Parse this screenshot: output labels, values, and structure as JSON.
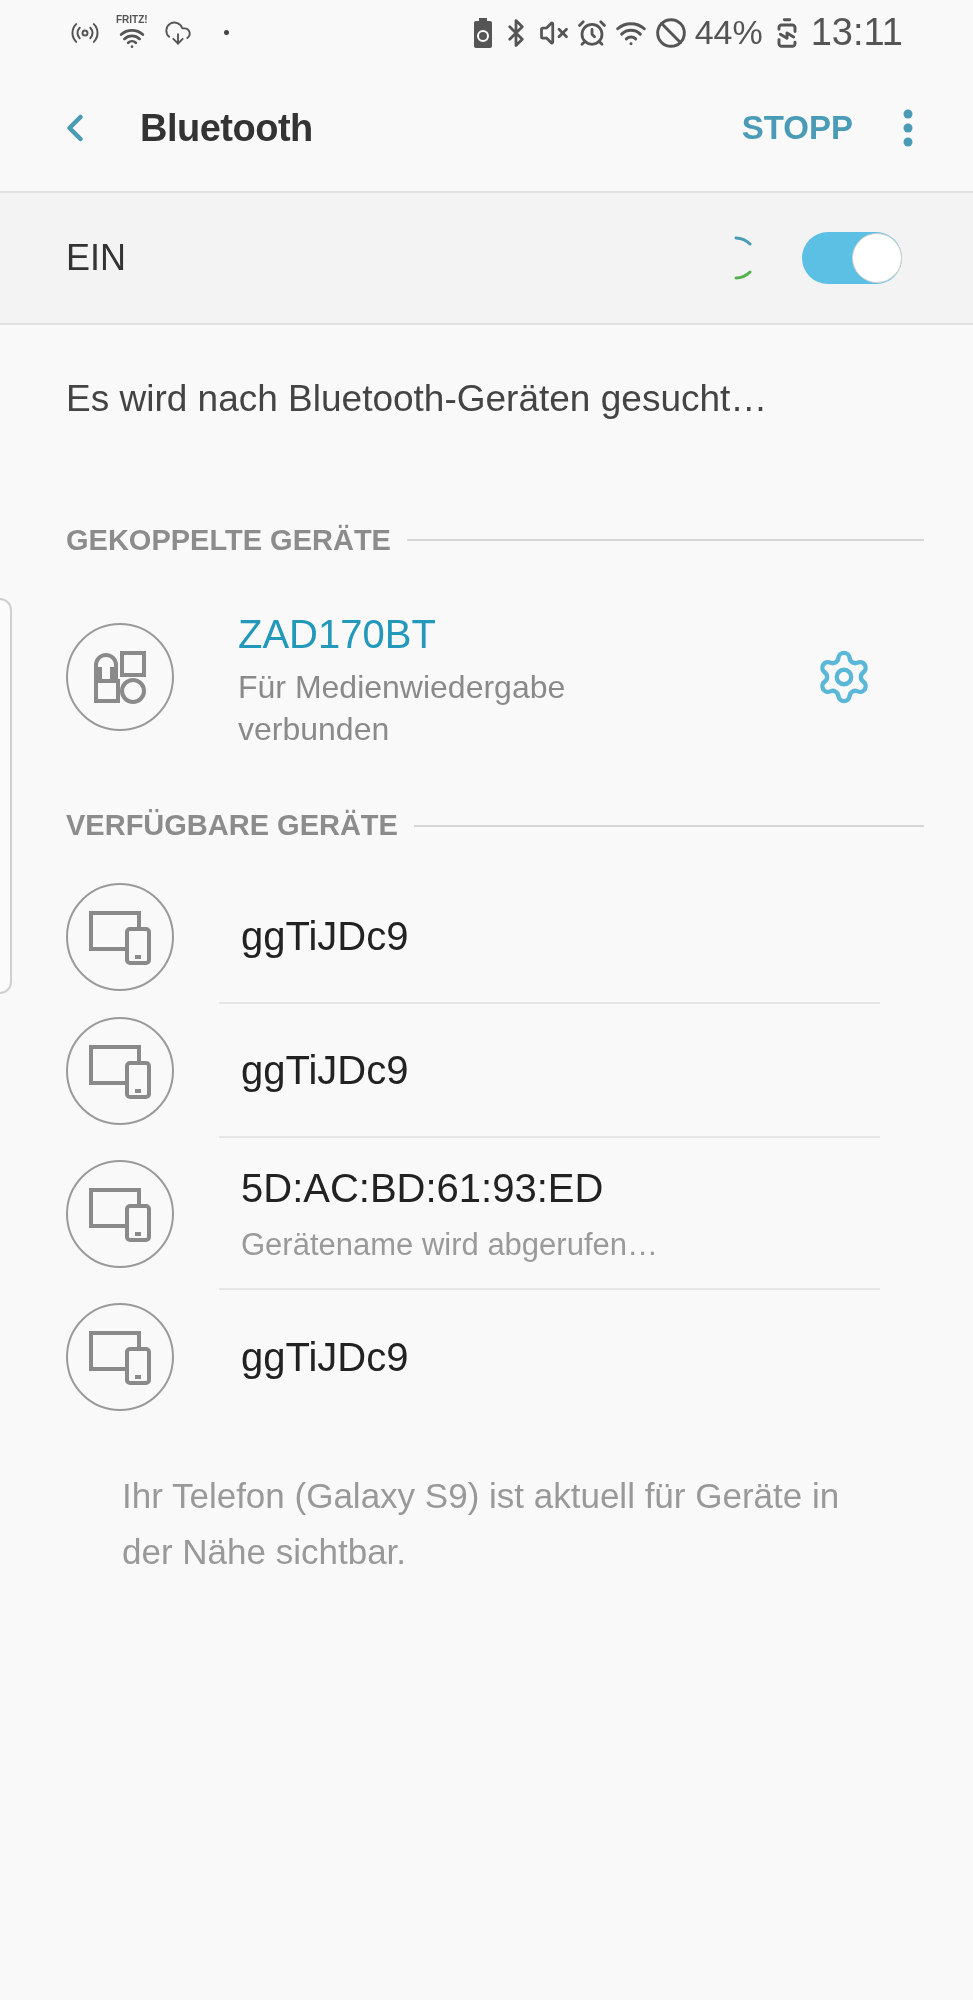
{
  "status_bar": {
    "network_label": "FRITZ!",
    "battery_percent": "44%",
    "time": "13:11"
  },
  "app_bar": {
    "title": "Bluetooth",
    "action": "STOPP"
  },
  "master_switch": {
    "label": "EIN",
    "on": true,
    "scanning": true
  },
  "scan_status": "Es wird nach Bluetooth-Geräten gesucht…",
  "paired_section": {
    "title": "GEKOPPELTE GERÄTE",
    "devices": [
      {
        "name": "ZAD170BT",
        "status": "Für Medienwiedergabe verbunden",
        "connected": true
      }
    ]
  },
  "available_section": {
    "title": "VERFÜGBARE GERÄTE",
    "devices": [
      {
        "name": "ggTiJDc9"
      },
      {
        "name": "ggTiJDc9"
      },
      {
        "name": "5D:AC:BD:61:93:ED",
        "status": "Gerätename wird abgerufen…"
      },
      {
        "name": "ggTiJDc9"
      }
    ]
  },
  "visibility_note": "Ihr Telefon (Galaxy S9) ist aktuell für Geräte in der Nähe sichtbar."
}
